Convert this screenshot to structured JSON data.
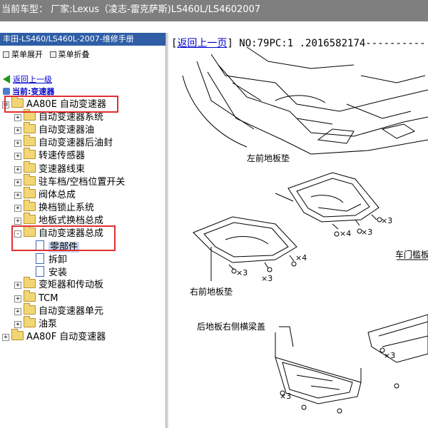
{
  "window": {
    "title": "当前车型： 厂家:Lexus（凌志-雷克萨斯)LS460L/LS4602007"
  },
  "left_panel": {
    "manual_title": "丰田-LS460/LS460L-2007-维修手册",
    "expand_all": "菜单展开",
    "collapse_all": "菜单折叠",
    "back_link": "返回上一级",
    "current_label": "当前:变速器"
  },
  "tree": [
    {
      "label": "AA80E 自动变速器",
      "level": 0,
      "expander": "⊟",
      "icon": "folder-icon"
    },
    {
      "label": "自动变速器系统",
      "level": 1,
      "expander": "+",
      "icon": "folder-icon"
    },
    {
      "label": "自动变速器油",
      "level": 1,
      "expander": "+",
      "icon": "folder-icon"
    },
    {
      "label": "自动变速器后油封",
      "level": 1,
      "expander": "+",
      "icon": "folder-icon"
    },
    {
      "label": "转速传感器",
      "level": 1,
      "expander": "+",
      "icon": "folder-icon"
    },
    {
      "label": "变速器线束",
      "level": 1,
      "expander": "+",
      "icon": "folder-icon"
    },
    {
      "label": "驻车档/空档位置开关",
      "level": 1,
      "expander": "+",
      "icon": "folder-icon"
    },
    {
      "label": "阀体总成",
      "level": 1,
      "expander": "+",
      "icon": "folder-icon"
    },
    {
      "label": "换档锁止系统",
      "level": 1,
      "expander": "+",
      "icon": "folder-icon"
    },
    {
      "label": "地板式换档总成",
      "level": 1,
      "expander": "+",
      "icon": "folder-icon"
    },
    {
      "label": "自动变速器总成",
      "level": 1,
      "expander": "-",
      "icon": "folder-icon"
    },
    {
      "label": "零部件",
      "level": 2,
      "expander": "",
      "icon": "document-icon",
      "selected": true
    },
    {
      "label": "拆卸",
      "level": 2,
      "expander": "",
      "icon": "document-icon"
    },
    {
      "label": "安装",
      "level": 2,
      "expander": "",
      "icon": "document-icon"
    },
    {
      "label": "变矩器和传动板",
      "level": 1,
      "expander": "+",
      "icon": "folder-icon"
    },
    {
      "label": "TCM",
      "level": 1,
      "expander": "+",
      "icon": "folder-icon"
    },
    {
      "label": "自动变速器单元",
      "level": 1,
      "expander": "+",
      "icon": "folder-icon"
    },
    {
      "label": "油泵",
      "level": 1,
      "expander": "+",
      "icon": "folder-icon"
    },
    {
      "label": "AA80F 自动变速器",
      "level": 0,
      "expander": "+",
      "icon": "folder-icon"
    }
  ],
  "right_panel": {
    "prev_page": "返回上一页",
    "doc_id": "NO:79PC:1 .2016582174----------",
    "diagram_labels": {
      "left_front": "左前地板垫",
      "right_front": "右前地板垫",
      "door_sill": "车门槛板",
      "rear_cover": "后地板右侧横梁盖",
      "x3": "×3",
      "x4": "×4"
    }
  },
  "colors": {
    "highlight": "#e03030",
    "selection": "#c9d7f0",
    "title_bar": "#7f7f7f",
    "manual_title_bg": "#2f5ea6"
  }
}
